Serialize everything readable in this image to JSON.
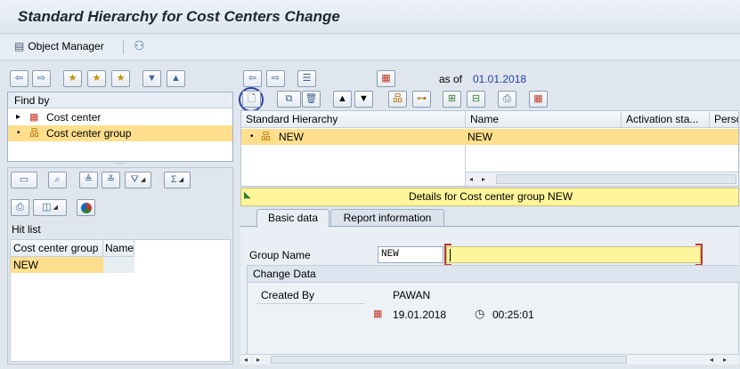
{
  "title": "Standard Hierarchy for Cost Centers Change",
  "app_toolbar": {
    "object_manager_label": "Object Manager"
  },
  "left_panel": {
    "find_by_label": "Find by",
    "tree_items": [
      {
        "label": "Cost center"
      },
      {
        "label": "Cost center group"
      }
    ],
    "hit_list_label": "Hit list",
    "hit_list_columns": [
      "Cost center group",
      "Name"
    ],
    "hit_list_rows": [
      [
        "NEW",
        ""
      ]
    ]
  },
  "hierarchy": {
    "as_of_label": "as of",
    "as_of_date": "01.01.2018",
    "columns": [
      "Standard Hierarchy",
      "Name",
      "Activation sta...",
      "Perso"
    ],
    "rows": [
      {
        "node": "NEW",
        "name": "NEW"
      }
    ]
  },
  "details": {
    "header": "Details for Cost center group NEW",
    "tabs": [
      "Basic data",
      "Report information"
    ],
    "group_name_label": "Group Name",
    "group_name_value": "NEW",
    "description_value": "",
    "change_data_label": "Change Data",
    "created_by_label": "Created By",
    "created_by_value": "PAWAN",
    "created_date": "19.01.2018",
    "created_time": "00:25:01"
  },
  "colors": {
    "selection": "#fddf8d",
    "header_title": "#1c2733",
    "date_link": "#1f3ea6",
    "detail_header_bg": "#fff59a",
    "focus_circle": "#2f3fa8"
  }
}
